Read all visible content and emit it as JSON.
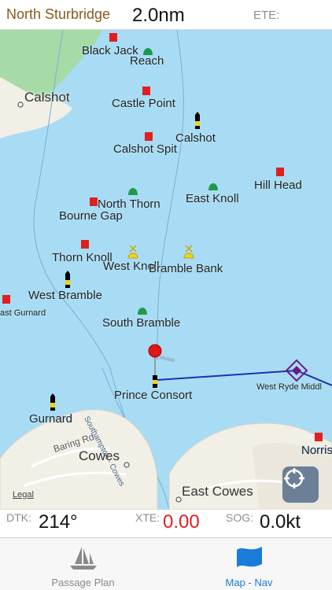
{
  "header": {
    "waypoint": "North Sturbridge",
    "distance": "2.0nm",
    "ete_label": "ETE:"
  },
  "map": {
    "labels": [
      {
        "id": "black-jack",
        "text": "Black Jack"
      },
      {
        "id": "reach",
        "text": "Reach"
      },
      {
        "id": "calshot-town",
        "text": "Calshot"
      },
      {
        "id": "castle-point",
        "text": "Castle Point"
      },
      {
        "id": "calshot-buoy",
        "text": "Calshot"
      },
      {
        "id": "calshot-spit",
        "text": "Calshot Spit"
      },
      {
        "id": "hill-head",
        "text": "Hill Head"
      },
      {
        "id": "east-knoll",
        "text": "East Knoll"
      },
      {
        "id": "north-thorn",
        "text": "North Thorn"
      },
      {
        "id": "bourne-gap",
        "text": "Bourne Gap"
      },
      {
        "id": "thorn-knoll",
        "text": "Thorn Knoll"
      },
      {
        "id": "west-knoll",
        "text": "West Knoll"
      },
      {
        "id": "bramble-bank",
        "text": "Bramble Bank"
      },
      {
        "id": "west-bramble",
        "text": "West Bramble"
      },
      {
        "id": "east-gurnard",
        "text": "ast Gurnard"
      },
      {
        "id": "south-bramble",
        "text": "South Bramble"
      },
      {
        "id": "prince-consort",
        "text": "Prince Consort"
      },
      {
        "id": "west-ryde-middle",
        "text": "West Ryde Middl"
      },
      {
        "id": "gurnard",
        "text": "Gurnard"
      },
      {
        "id": "norris",
        "text": "Norris"
      },
      {
        "id": "baring-rd",
        "text": "Baring Rd"
      },
      {
        "id": "cowes",
        "text": "Cowes"
      },
      {
        "id": "east-cowes",
        "text": "East Cowes"
      },
      {
        "id": "channel",
        "text": "Southampton - Cowes"
      },
      {
        "id": "legal",
        "text": "Legal"
      }
    ]
  },
  "status": {
    "dtk_label": "DTK:",
    "dtk_value": "214°",
    "xte_label": "XTE:",
    "xte_value": "0.00",
    "sog_label": "SOG:",
    "sog_value": "0.0kt"
  },
  "tabs": [
    {
      "label": "Passage Plan",
      "icon": "sailboat-icon",
      "active": false
    },
    {
      "label": "Map - Nav",
      "icon": "flag-icon",
      "active": true
    }
  ],
  "colors": {
    "water": "#a8dcf4",
    "land": "#f2efe6",
    "green_land": "#a6dba8",
    "route": "#1f2fb0",
    "active_tab": "#1a7bd8",
    "xte_value": "#e02020",
    "waypoint_text": "#8a5a1e"
  }
}
